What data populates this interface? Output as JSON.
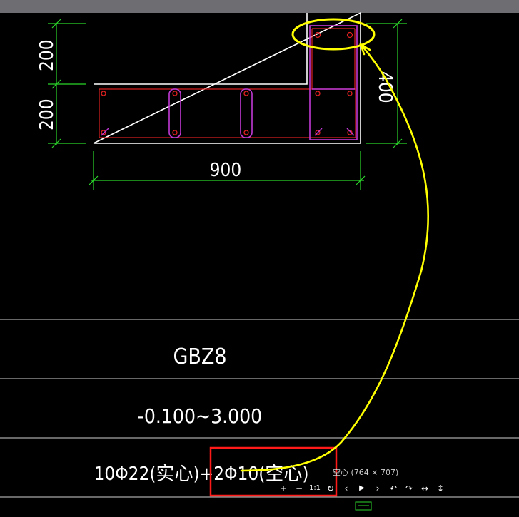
{
  "drawing": {
    "dimensions": {
      "left_upper": "200",
      "left_lower": "200",
      "right": "400",
      "bottom": "900"
    },
    "table": {
      "name": "GBZ8",
      "elevation": "-0.100~3.000",
      "rebar": "10Φ22(实心)+2Φ10(空心)"
    }
  },
  "viewer": {
    "caption": "空心 (764 × 707)",
    "toolbar": [
      {
        "icon": "zoom-in-icon",
        "glyph": "+"
      },
      {
        "icon": "zoom-out-icon",
        "glyph": "−"
      },
      {
        "icon": "actual-size-icon",
        "glyph": "1:1"
      },
      {
        "icon": "reset-icon",
        "glyph": "↻"
      },
      {
        "icon": "prev-icon",
        "glyph": "‹"
      },
      {
        "icon": "play-icon",
        "glyph": "▶"
      },
      {
        "icon": "next-icon",
        "glyph": "›"
      },
      {
        "icon": "rotate-left-icon",
        "glyph": "↶"
      },
      {
        "icon": "rotate-right-icon",
        "glyph": "↷"
      },
      {
        "icon": "flip-horizontal-icon",
        "glyph": "↔"
      },
      {
        "icon": "flip-vertical-icon",
        "glyph": "↕"
      }
    ]
  },
  "colors": {
    "outline": "#ffffff",
    "dimension": "#2bd52b",
    "stirrup": "#c23ad6",
    "rebar": "#e02020",
    "annotation_yellow": "#ffff00",
    "highlight_red": "#ff1a1a"
  }
}
